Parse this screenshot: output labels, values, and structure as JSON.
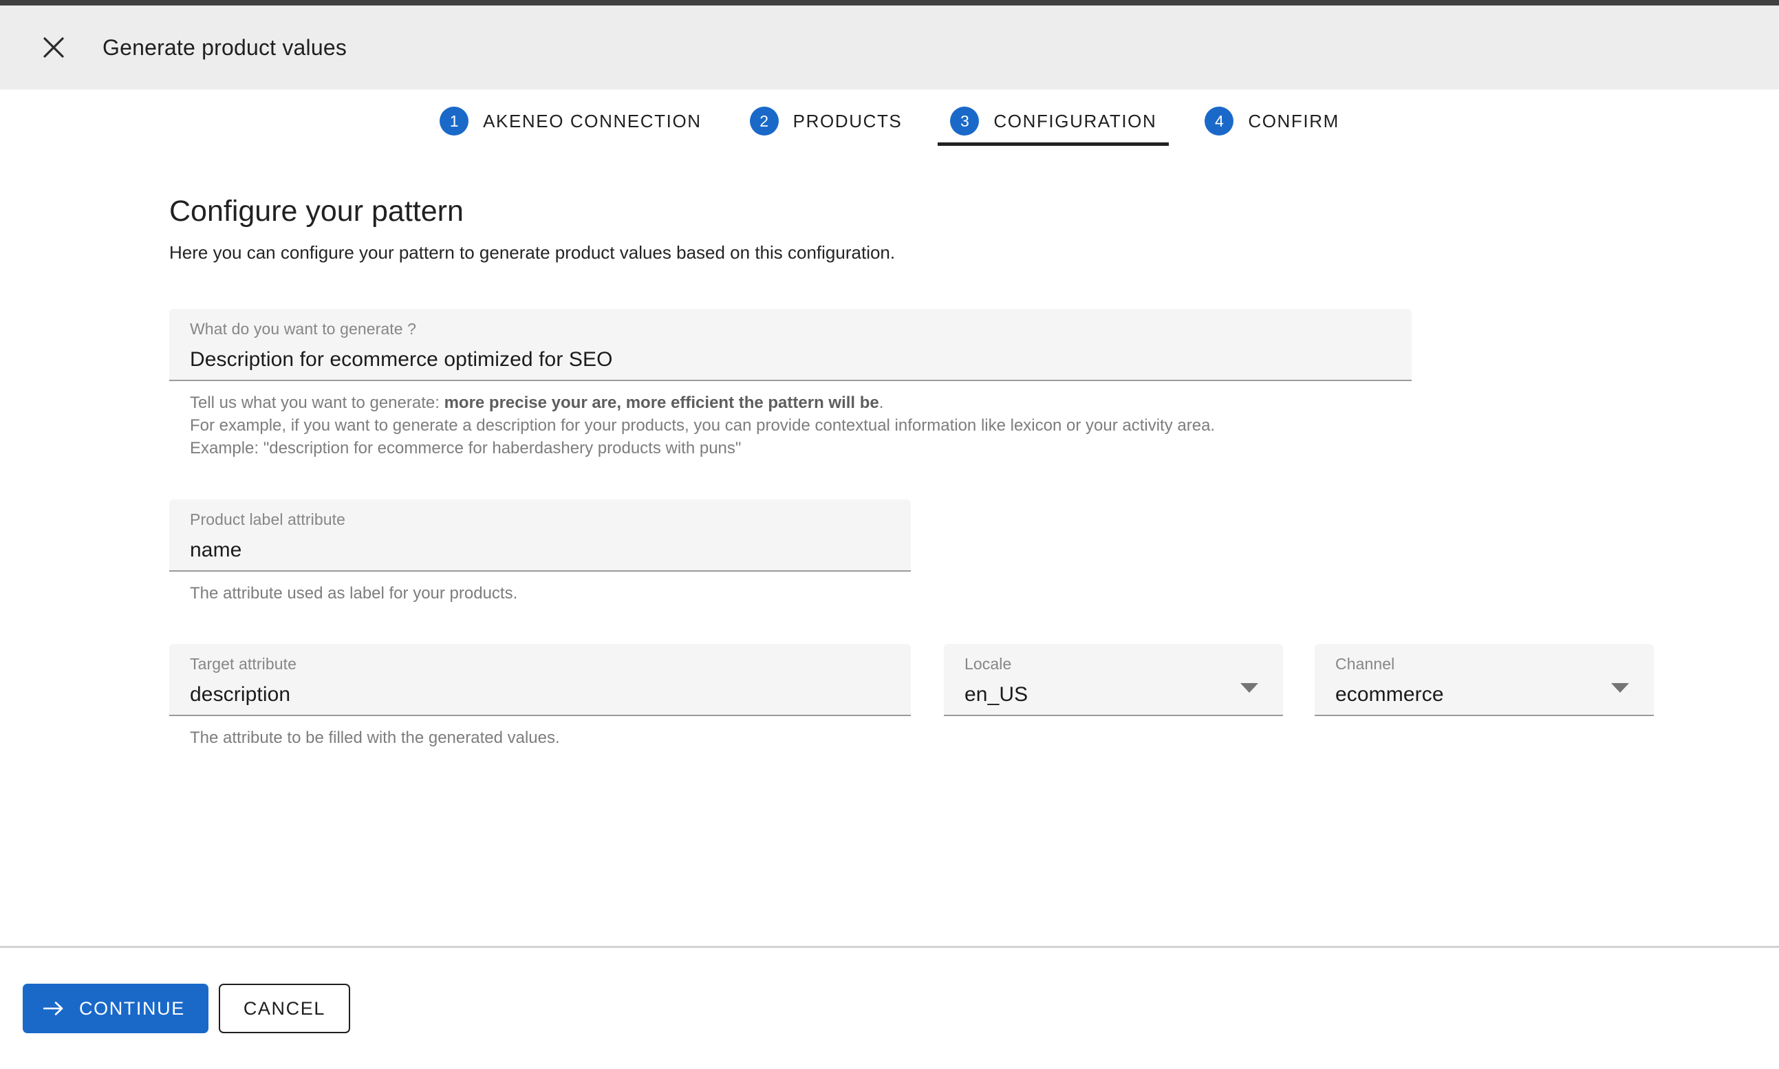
{
  "window": {
    "header": {
      "title": "Generate product values",
      "close_icon": "close-icon"
    }
  },
  "stepper": {
    "active_index": 2,
    "steps": [
      {
        "number": "1",
        "label": "AKENEO CONNECTION"
      },
      {
        "number": "2",
        "label": "PRODUCTS"
      },
      {
        "number": "3",
        "label": "CONFIGURATION"
      },
      {
        "number": "4",
        "label": "CONFIRM"
      }
    ]
  },
  "main": {
    "title": "Configure your pattern",
    "subtitle": "Here you can configure your pattern to generate product values based on this configuration.",
    "fields": {
      "generate": {
        "label": "What do you want to generate ?",
        "value": "Description for ecommerce optimized for SEO",
        "helper_line1_prefix": "Tell us what you want to generate: ",
        "helper_line1_bold": "more precise your are, more efficient the pattern will be",
        "helper_line1_suffix": ".",
        "helper_line2": "For example, if you want to generate a description for your products, you can provide contextual information like lexicon or your activity area.",
        "helper_line3": "Example: \"description for ecommerce for haberdashery products with puns\""
      },
      "product_label_attribute": {
        "label": "Product label attribute",
        "value": "name",
        "helper": "The attribute used as label for your products."
      },
      "target_attribute": {
        "label": "Target attribute",
        "value": "description",
        "helper": "The attribute to be filled with the generated values."
      },
      "locale": {
        "label": "Locale",
        "value": "en_US",
        "arrow_icon": "chevron-down-icon"
      },
      "channel": {
        "label": "Channel",
        "value": "ecommerce",
        "arrow_icon": "chevron-down-icon"
      }
    }
  },
  "footer": {
    "continue_label": "CONTINUE",
    "continue_icon": "arrow-right-icon",
    "cancel_label": "CANCEL"
  },
  "colors": {
    "accent_blue": "#1a69c9",
    "header_bg": "#ededed",
    "field_bg": "#f5f5f5",
    "active_underline": "#212121"
  }
}
